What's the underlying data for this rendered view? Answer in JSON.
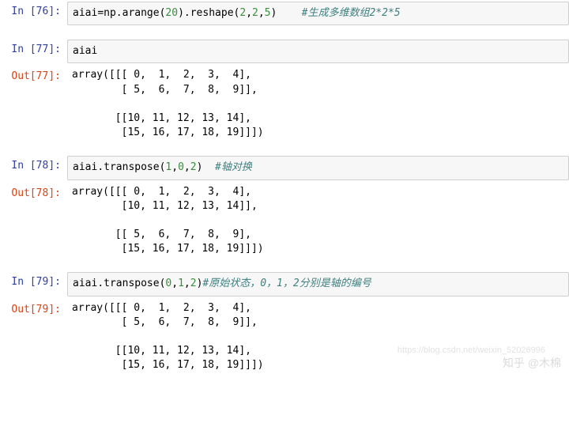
{
  "cells": [
    {
      "kind": "in",
      "n": "76",
      "segments": [
        {
          "t": "aiai",
          "c": "ident"
        },
        {
          "t": "=",
          "c": "op"
        },
        {
          "t": "np",
          "c": "ident"
        },
        {
          "t": ".",
          "c": "op"
        },
        {
          "t": "arange",
          "c": "ident"
        },
        {
          "t": "(",
          "c": "op"
        },
        {
          "t": "20",
          "c": "num"
        },
        {
          "t": ")",
          "c": "op"
        },
        {
          "t": ".",
          "c": "op"
        },
        {
          "t": "reshape",
          "c": "ident"
        },
        {
          "t": "(",
          "c": "op"
        },
        {
          "t": "2",
          "c": "num"
        },
        {
          "t": ",",
          "c": "op"
        },
        {
          "t": "2",
          "c": "num"
        },
        {
          "t": ",",
          "c": "op"
        },
        {
          "t": "5",
          "c": "num"
        },
        {
          "t": ")",
          "c": "op"
        },
        {
          "t": "    ",
          "c": "op"
        },
        {
          "t": "#生成多维数组2*2*5",
          "c": "comment"
        }
      ]
    },
    {
      "kind": "gap"
    },
    {
      "kind": "in",
      "n": "77",
      "segments": [
        {
          "t": "aiai",
          "c": "ident"
        }
      ]
    },
    {
      "kind": "out",
      "n": "77",
      "text": "array([[[ 0,  1,  2,  3,  4],\n        [ 5,  6,  7,  8,  9]],\n\n       [[10, 11, 12, 13, 14],\n        [15, 16, 17, 18, 19]]])"
    },
    {
      "kind": "gap"
    },
    {
      "kind": "in",
      "n": "78",
      "segments": [
        {
          "t": "aiai",
          "c": "ident"
        },
        {
          "t": ".",
          "c": "op"
        },
        {
          "t": "transpose",
          "c": "ident"
        },
        {
          "t": "(",
          "c": "op"
        },
        {
          "t": "1",
          "c": "num"
        },
        {
          "t": ",",
          "c": "op"
        },
        {
          "t": "0",
          "c": "num"
        },
        {
          "t": ",",
          "c": "op"
        },
        {
          "t": "2",
          "c": "num"
        },
        {
          "t": ")",
          "c": "op"
        },
        {
          "t": "  ",
          "c": "op"
        },
        {
          "t": "#轴对换",
          "c": "comment"
        }
      ]
    },
    {
      "kind": "out",
      "n": "78",
      "text": "array([[[ 0,  1,  2,  3,  4],\n        [10, 11, 12, 13, 14]],\n\n       [[ 5,  6,  7,  8,  9],\n        [15, 16, 17, 18, 19]]])"
    },
    {
      "kind": "gap"
    },
    {
      "kind": "in",
      "n": "79",
      "segments": [
        {
          "t": "aiai",
          "c": "ident"
        },
        {
          "t": ".",
          "c": "op"
        },
        {
          "t": "transpose",
          "c": "ident"
        },
        {
          "t": "(",
          "c": "op"
        },
        {
          "t": "0",
          "c": "num"
        },
        {
          "t": ",",
          "c": "op"
        },
        {
          "t": "1",
          "c": "num"
        },
        {
          "t": ",",
          "c": "op"
        },
        {
          "t": "2",
          "c": "num"
        },
        {
          "t": ")",
          "c": "op"
        },
        {
          "t": "#原始状态，0，1，2分别是轴的编号",
          "c": "comment"
        }
      ]
    },
    {
      "kind": "out",
      "n": "79",
      "text": "array([[[ 0,  1,  2,  3,  4],\n        [ 5,  6,  7,  8,  9]],\n\n       [[10, 11, 12, 13, 14],\n        [15, 16, 17, 18, 19]]])"
    }
  ],
  "watermark_main": "知乎 @木棉",
  "watermark_sub": "https://blog.csdn.net/weixin_52026996"
}
